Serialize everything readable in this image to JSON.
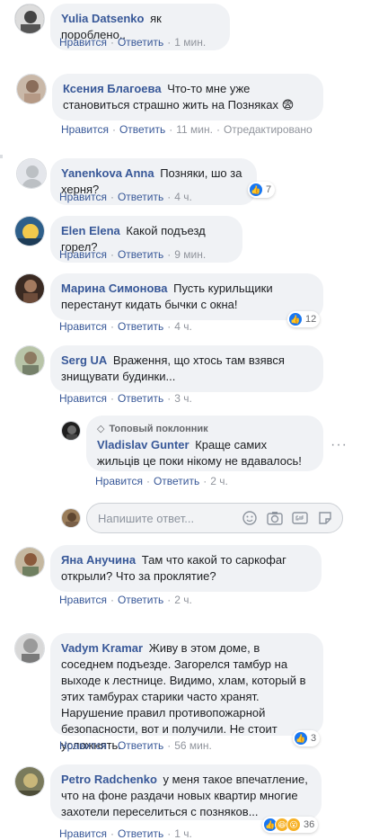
{
  "actions": {
    "like": "Нравится",
    "reply": "Ответить",
    "edited": "Отредактировано"
  },
  "reply_placeholder": "Напишите ответ...",
  "top_fan_label": "Топовый поклонник",
  "comments": [
    {
      "author": "Yulia Datsenko",
      "text": "як пороблено..",
      "time": "1 мин."
    },
    {
      "author": "Ксения Благоева",
      "text": "Что-то мне уже становиться страшно жить на Позняках 😨",
      "time": "11 мин."
    },
    {
      "author": "Yanenkova Anna",
      "text": "Позняки, шо за херня?",
      "time": "4 ч.",
      "reactions": "7"
    },
    {
      "author": "Elen Elena",
      "text": "Какой подъезд горел?",
      "time": "9 мин."
    },
    {
      "author": "Марина Симонова",
      "text": "Пусть курильщики перестанут кидать бычки с окна!",
      "time": "4 ч.",
      "reactions": "12"
    },
    {
      "author": "Serg UA",
      "text": "Враження, що хтось там взявся знищувати будинки...",
      "time": "3 ч."
    },
    {
      "author": "Vladislav Gunter",
      "text": "Краще самих жильців це поки нікому не вдавалось!",
      "time": "2 ч."
    },
    {
      "author": "Яна Анучина",
      "text": "Там что какой то саркофаг открыли? Что за проклятие?",
      "time": "2 ч."
    },
    {
      "author": "Vadym Kramar",
      "text": "Живу в этом доме, в соседнем подъезде. Загорелся тамбур на выходе к лестнице. Видимо, хлам, который в этих тамбурах старики часто хранят. Нарушение правил противопожарной безопасности, вот и получили. Не стоит усложнять.",
      "time": "56 мин.",
      "reactions": "3"
    },
    {
      "author": "Petro Radchenko",
      "text": "у меня такое впечатление, что на фоне раздачи новых квартир многие захотели переселиться с позняков...",
      "time": "1 ч.",
      "reactions": "36"
    }
  ]
}
